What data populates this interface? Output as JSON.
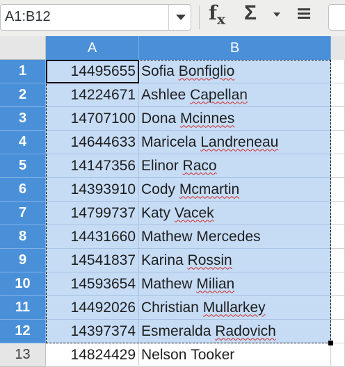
{
  "toolbar": {
    "name_box_value": "A1:B12",
    "function_wizard_icon": "fx-icon",
    "sum_icon": "sigma-icon",
    "formula_icon": "equals-icon"
  },
  "columns": [
    "A",
    "B"
  ],
  "rows": [
    {
      "num": "1",
      "id": "14495655",
      "name_first": "Sofia",
      "name_last": "Bonfiglio",
      "selected": true
    },
    {
      "num": "2",
      "id": "14224671",
      "name_first": "Ashlee",
      "name_last": "Capellan",
      "selected": true
    },
    {
      "num": "3",
      "id": "14707100",
      "name_first": "Dona",
      "name_last": "Mcinnes",
      "selected": true
    },
    {
      "num": "4",
      "id": "14644633",
      "name_first": "Maricela",
      "name_last": "Landreneau",
      "selected": true
    },
    {
      "num": "5",
      "id": "14147356",
      "name_first": "Elinor",
      "name_last": "Raco",
      "selected": true
    },
    {
      "num": "6",
      "id": "14393910",
      "name_first": "Cody",
      "name_last": "Mcmartin",
      "selected": true
    },
    {
      "num": "7",
      "id": "14799737",
      "name_first": "Katy",
      "name_last": "Vacek",
      "selected": true
    },
    {
      "num": "8",
      "id": "14431660",
      "name_first": "Mathew",
      "name_last": "Mercedes",
      "selected": true
    },
    {
      "num": "9",
      "id": "14541837",
      "name_first": "Karina",
      "name_last": "Rossin",
      "selected": true
    },
    {
      "num": "10",
      "id": "14593654",
      "name_first": "Mathew",
      "name_last": "Milian",
      "selected": true
    },
    {
      "num": "11",
      "id": "14492026",
      "name_first": "Christian",
      "name_last": "Mullarkey",
      "selected": true
    },
    {
      "num": "12",
      "id": "14397374",
      "name_first": "Esmeralda",
      "name_last": "Radovich",
      "selected": true
    },
    {
      "num": "13",
      "id": "14824429",
      "name_first": "Nelson",
      "name_last": "Tooker",
      "selected": false
    }
  ],
  "misspelled_last_names": [
    "Bonfiglio",
    "Capellan",
    "Mcinnes",
    "Landreneau",
    "Raco",
    "Mcmartin",
    "Vacek",
    "Rossin",
    "Milian",
    "Mullarkey",
    "Radovich"
  ]
}
